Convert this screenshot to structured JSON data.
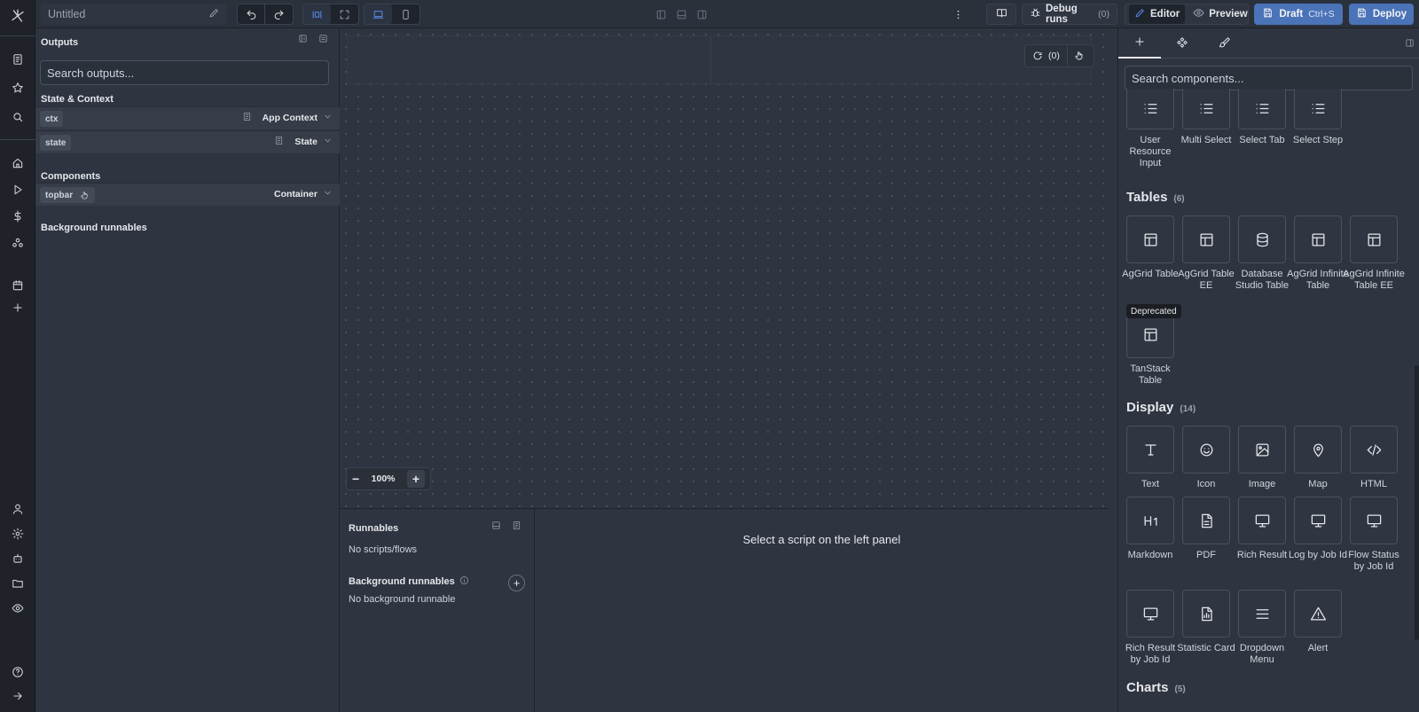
{
  "topbar": {
    "title": "Untitled",
    "debug_runs_label": "Debug runs",
    "debug_runs_count": "(0)",
    "editor_label": "Editor",
    "preview_label": "Preview",
    "draft_label": "Draft",
    "draft_shortcut": "Ctrl+S",
    "deploy_label": "Deploy"
  },
  "outputs": {
    "title": "Outputs",
    "search_placeholder": "Search outputs...",
    "state_context_heading": "State & Context",
    "state_rows": [
      {
        "key": "ctx",
        "type": "App Context"
      },
      {
        "key": "state",
        "type": "State"
      }
    ],
    "components_heading": "Components",
    "component_rows": [
      {
        "key": "topbar",
        "type": "Container"
      }
    ],
    "background_heading": "Background runnables"
  },
  "canvas": {
    "refresh_count": "(0)",
    "zoom_level": "100%"
  },
  "runnables": {
    "title": "Runnables",
    "empty_text": "No scripts/flows",
    "background_title": "Background runnables",
    "background_empty": "No background runnable"
  },
  "script_pane": {
    "message": "Select a script on the left panel"
  },
  "components_panel": {
    "search_placeholder": "Search components...",
    "inputs_partial": [
      "User Resource Input",
      "Multi Select",
      "Select Tab",
      "Select Step"
    ],
    "tables": {
      "heading": "Tables",
      "count": "(6)",
      "items": [
        "AgGrid Table",
        "AgGrid Table EE",
        "Database Studio Table",
        "AgGrid Infinite Table",
        "AgGrid Infinite Table EE",
        "TanStack Table"
      ],
      "deprecated_badge": "Deprecated"
    },
    "display": {
      "heading": "Display",
      "count": "(14)",
      "items": [
        "Text",
        "Icon",
        "Image",
        "Map",
        "HTML",
        "Markdown",
        "PDF",
        "Rich Result",
        "Log by Job Id",
        "Flow Status by Job Id",
        "Rich Result by Job Id",
        "Statistic Card",
        "Dropdown Menu",
        "Alert"
      ]
    },
    "charts": {
      "heading": "Charts",
      "count": "(5)"
    }
  }
}
